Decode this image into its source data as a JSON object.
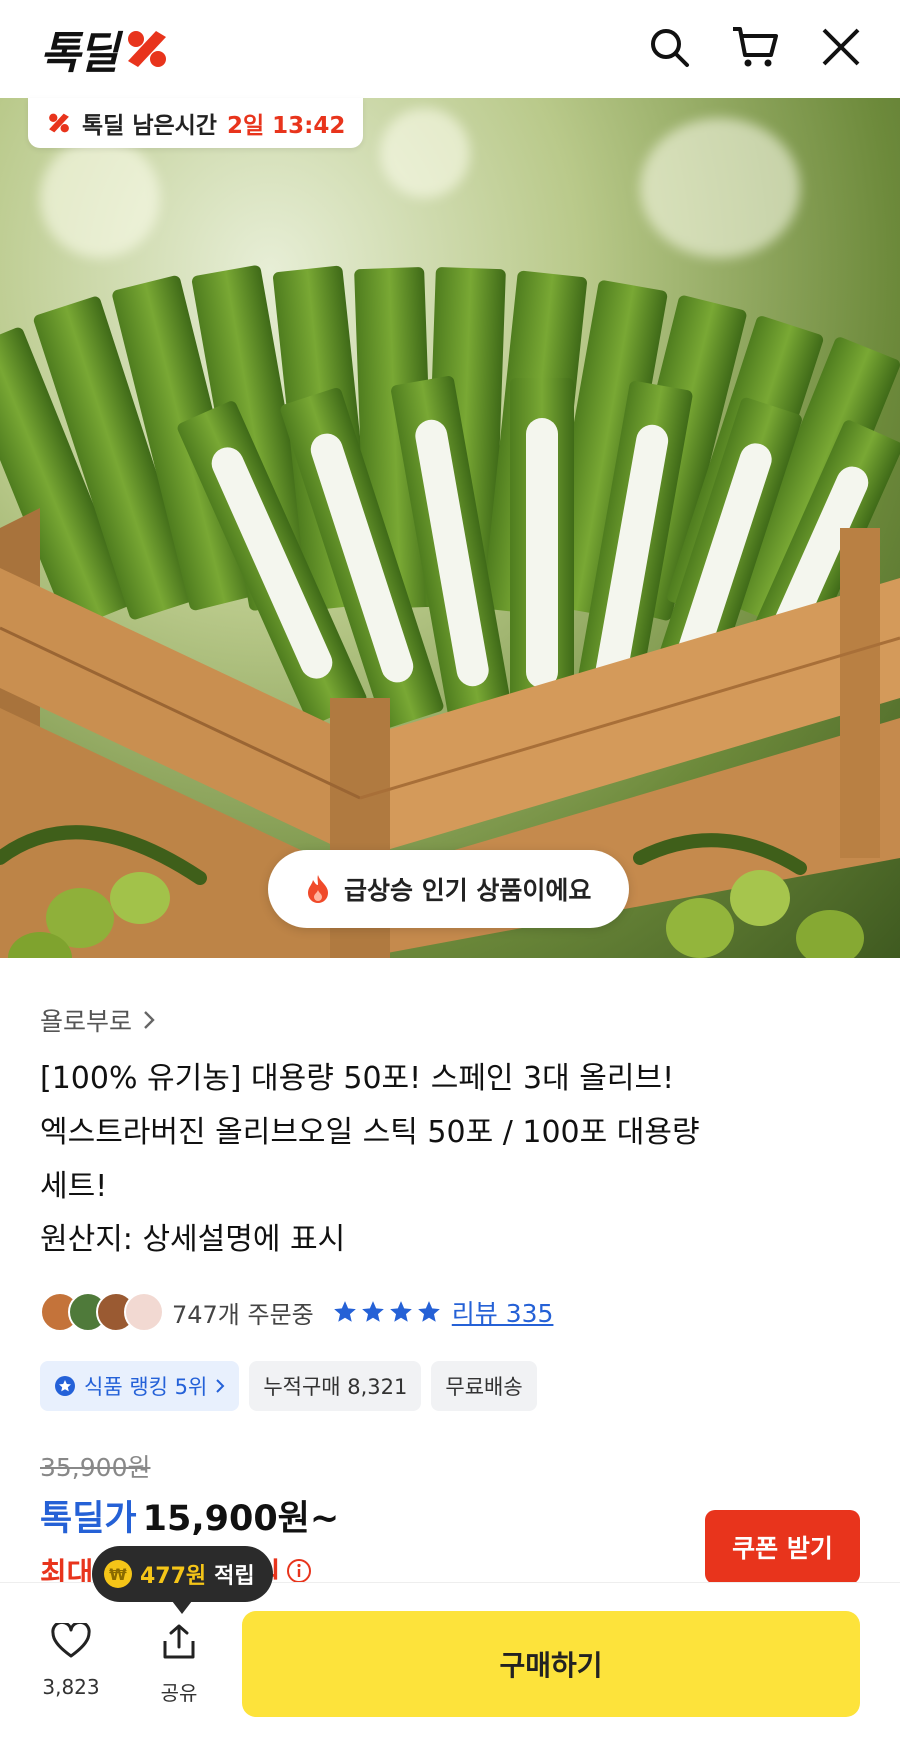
{
  "header": {
    "logo_text": "톡딜",
    "icons": [
      "search-icon",
      "cart-icon",
      "close-icon"
    ]
  },
  "hero": {
    "timer_label": "톡딜 남은시간",
    "timer_value": "2일 13:42",
    "hot_label": "급상승 인기 상품이에요"
  },
  "product": {
    "store": "욜로부로",
    "title_lines": [
      "[100% 유기농] 대용량 50포! 스페인 3대 올리브!",
      "엑스트라버진 올리브오일 스틱 50포 / 100포 대용량",
      "세트!"
    ],
    "origin": "원산지: 상세설명에 표시",
    "orders": "747개 주문중",
    "rating_stars": 4,
    "review_label": "리뷰 335",
    "chips": {
      "rank": "식품 랭킹 5위",
      "cumulative": "누적구매 8,321",
      "shipping": "무료배송"
    },
    "original_price": "35,900원",
    "deal_label": "톡딜가",
    "deal_price": "15,900원~",
    "max_prefix": "최대",
    "max_suffix": "00원",
    "coupon_button": "쿠폰 받기",
    "points_value": "477원",
    "points_label": "적립"
  },
  "bottom": {
    "like_count": "3,823",
    "share_label": "공유",
    "buy_button": "구매하기"
  },
  "colors": {
    "accent_red": "#e8341c",
    "link_blue": "#2561d6",
    "buy_yellow": "#fde33b"
  }
}
